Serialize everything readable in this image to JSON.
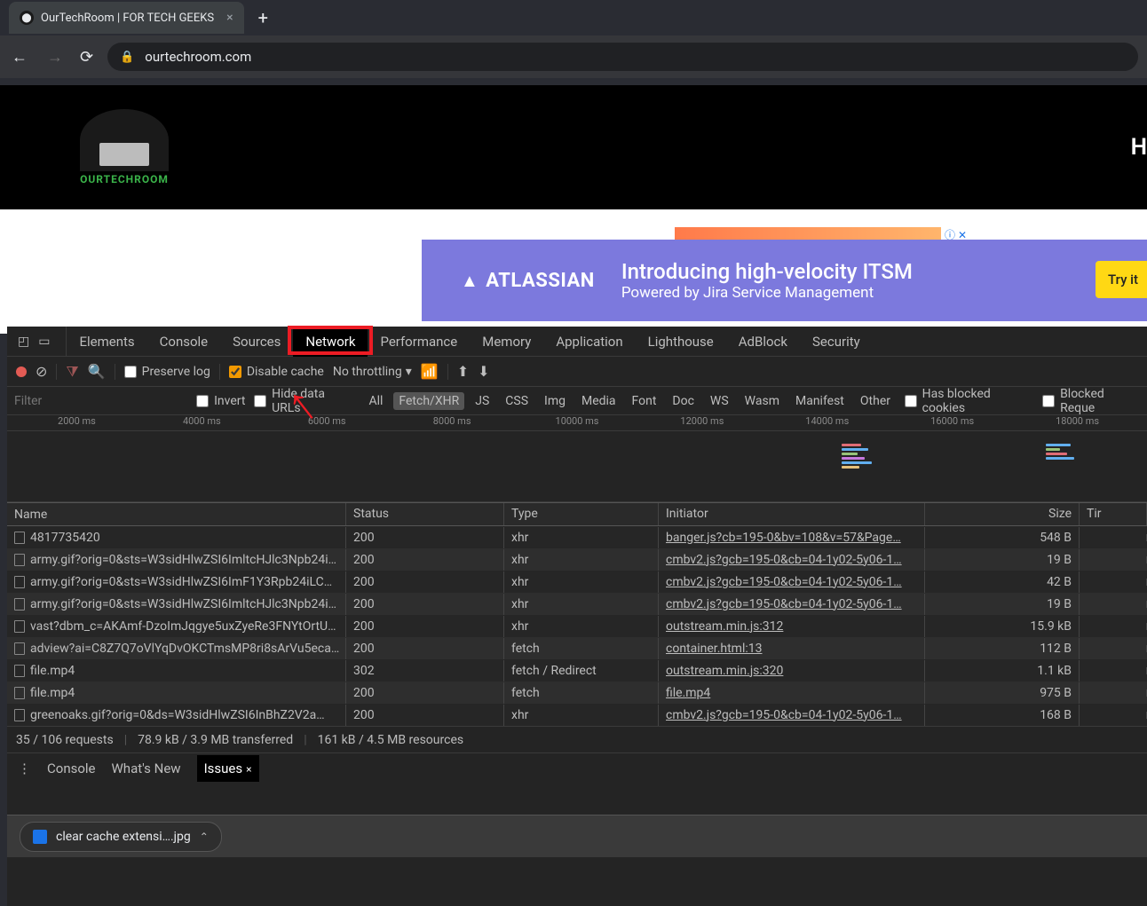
{
  "browser": {
    "tab_title": "OurTechRoom | FOR TECH GEEKS",
    "url": "ourtechroom.com"
  },
  "site": {
    "logo_text": "OURTECHROOM",
    "header_right": "H"
  },
  "ad": {
    "logo": "ATLASSIAN",
    "line1": "Introducing high-velocity ITSM",
    "line2": "Powered by Jira Service Management",
    "cta": "Try it"
  },
  "devtools": {
    "panels": [
      "Elements",
      "Console",
      "Sources",
      "Network",
      "Performance",
      "Memory",
      "Application",
      "Lighthouse",
      "AdBlock",
      "Security"
    ],
    "active_panel": "Network",
    "toolbar": {
      "preserve_log": "Preserve log",
      "disable_cache": "Disable cache",
      "throttling": "No throttling"
    },
    "filter": {
      "placeholder": "Filter",
      "invert": "Invert",
      "hide_data": "Hide data URLs",
      "types": [
        "All",
        "Fetch/XHR",
        "JS",
        "CSS",
        "Img",
        "Media",
        "Font",
        "Doc",
        "WS",
        "Wasm",
        "Manifest",
        "Other"
      ],
      "selected_type": "Fetch/XHR",
      "blocked_cookies": "Has blocked cookies",
      "blocked_req": "Blocked Reque"
    },
    "timeline": [
      "2000 ms",
      "4000 ms",
      "6000 ms",
      "8000 ms",
      "10000 ms",
      "12000 ms",
      "14000 ms",
      "16000 ms",
      "18000 ms"
    ],
    "columns": {
      "name": "Name",
      "status": "Status",
      "type": "Type",
      "initiator": "Initiator",
      "size": "Size",
      "time": "Tir"
    },
    "rows": [
      {
        "name": "4817735420",
        "status": "200",
        "type": "xhr",
        "initiator": "banger.js?cb=195-0&bv=108&v=57&Page…",
        "size": "548 B"
      },
      {
        "name": "army.gif?orig=0&sts=W3sidHlwZSI6ImltcHJlc3Npb24i…",
        "status": "200",
        "type": "xhr",
        "initiator": "cmbv2.js?gcb=195-0&cb=04-1y02-5y06-1…",
        "size": "19 B"
      },
      {
        "name": "army.gif?orig=0&sts=W3sidHlwZSI6ImF1Y3Rpb24iLC…",
        "status": "200",
        "type": "xhr",
        "initiator": "cmbv2.js?gcb=195-0&cb=04-1y02-5y06-1…",
        "size": "42 B"
      },
      {
        "name": "army.gif?orig=0&sts=W3sidHlwZSI6ImltcHJlc3Npb24i…",
        "status": "200",
        "type": "xhr",
        "initiator": "cmbv2.js?gcb=195-0&cb=04-1y02-5y06-1…",
        "size": "19 B"
      },
      {
        "name": "vast?dbm_c=AKAmf-DzoImJqgye5uxZyeRe3FNYtOrtU…",
        "status": "200",
        "type": "xhr",
        "initiator": "outstream.min.js:312",
        "size": "15.9 kB"
      },
      {
        "name": "adview?ai=C8Z7Q7oVlYqDvOKCTmsMP8ri8sArVu5eca…",
        "status": "200",
        "type": "fetch",
        "initiator": "container.html:13",
        "size": "112 B"
      },
      {
        "name": "file.mp4",
        "status": "302",
        "type": "fetch / Redirect",
        "initiator": "outstream.min.js:320",
        "size": "1.1 kB"
      },
      {
        "name": "file.mp4",
        "status": "200",
        "type": "fetch",
        "initiator": "file.mp4",
        "size": "975 B"
      },
      {
        "name": "greenoaks.gif?orig=0&ds=W3sidHlwZSI6InBhZ2V2a…",
        "status": "200",
        "type": "xhr",
        "initiator": "cmbv2.js?gcb=195-0&cb=04-1y02-5y06-1…",
        "size": "168 B"
      }
    ],
    "status": {
      "requests": "35 / 106 requests",
      "transferred": "78.9 kB / 3.9 MB transferred",
      "resources": "161 kB / 4.5 MB resources"
    },
    "drawer": {
      "tabs": [
        "Console",
        "What's New",
        "Issues"
      ],
      "active": "Issues"
    }
  },
  "download": {
    "filename": "clear cache extensi….jpg"
  }
}
